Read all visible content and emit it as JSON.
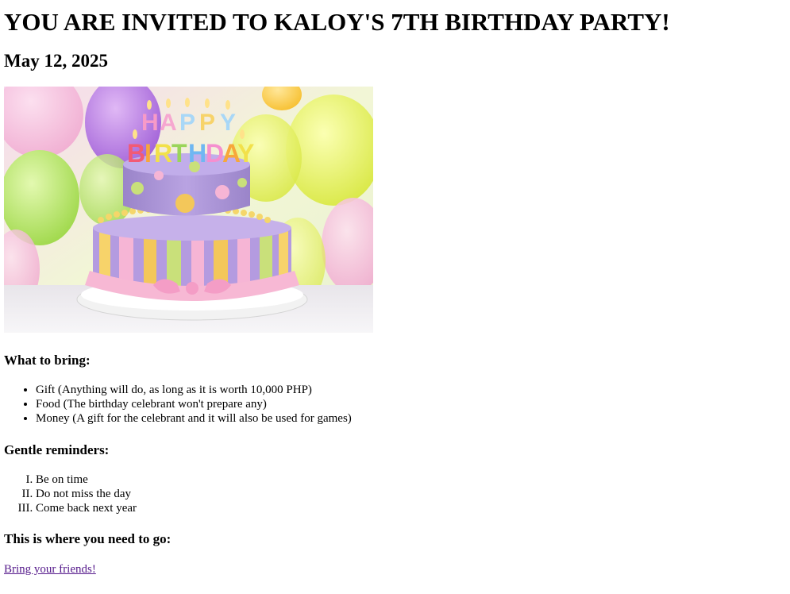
{
  "header": {
    "title": "YOU ARE INVITED TO KALOY'S 7TH BIRTHDAY PARTY!",
    "date": "May 12, 2025"
  },
  "image": {
    "icon": "birthday-cake-image",
    "candle_text_top": "HAPPY",
    "candle_text_bottom": "BIRTHDAY"
  },
  "bring": {
    "heading": "What to bring:",
    "items": [
      "Gift (Anything will do, as long as it is worth 10,000 PHP)",
      "Food (The birthday celebrant won't prepare any)",
      "Money (A gift for the celebrant and it will also be used for games)"
    ]
  },
  "reminders": {
    "heading": "Gentle reminders:",
    "items": [
      "Be on time",
      "Do not miss the day",
      "Come back next year"
    ]
  },
  "location": {
    "heading": "This is where you need to go:"
  },
  "link": {
    "label": "Bring your friends!"
  }
}
